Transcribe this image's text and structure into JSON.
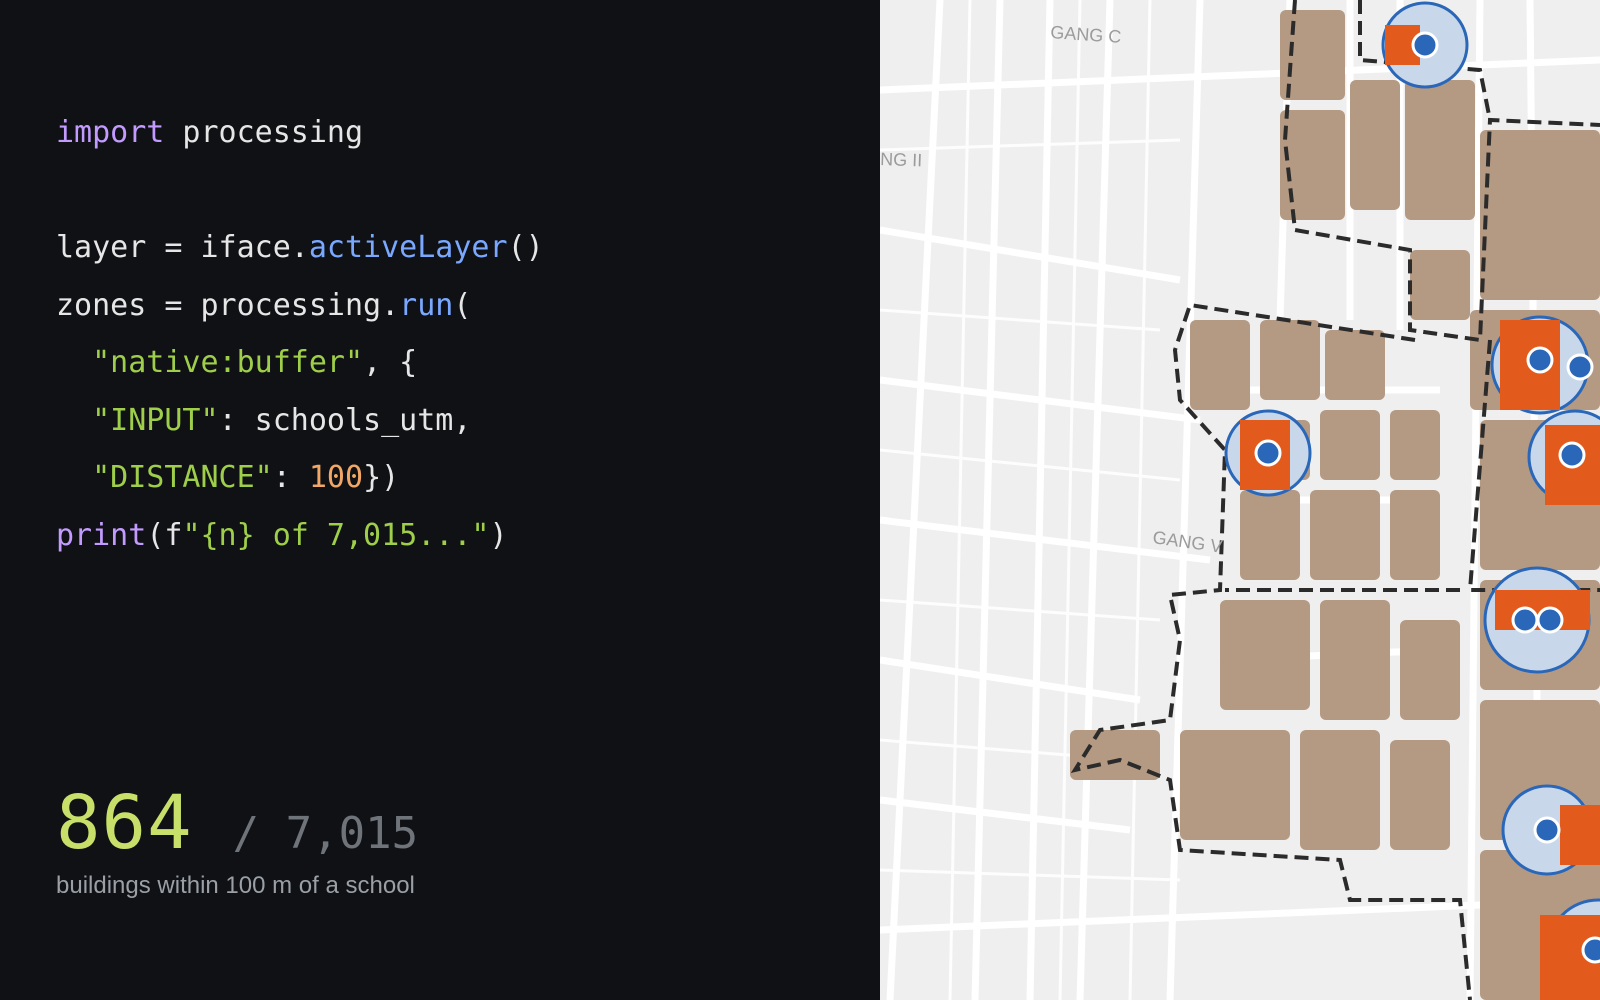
{
  "code_lines": [
    [
      {
        "t": "import",
        "c": "kw"
      },
      {
        "t": " processing",
        "c": ""
      }
    ],
    [],
    [
      {
        "t": "layer = iface.",
        "c": ""
      },
      {
        "t": "activeLayer",
        "c": "fn"
      },
      {
        "t": "()",
        "c": ""
      }
    ],
    [
      {
        "t": "zones = processing.",
        "c": ""
      },
      {
        "t": "run",
        "c": "fn"
      },
      {
        "t": "(",
        "c": ""
      }
    ],
    [
      {
        "t": "  ",
        "c": ""
      },
      {
        "t": "\"native:buffer\"",
        "c": "str"
      },
      {
        "t": ", {",
        "c": ""
      }
    ],
    [
      {
        "t": "  ",
        "c": ""
      },
      {
        "t": "\"INPUT\"",
        "c": "str"
      },
      {
        "t": ": schools_utm,",
        "c": ""
      }
    ],
    [
      {
        "t": "  ",
        "c": ""
      },
      {
        "t": "\"DISTANCE\"",
        "c": "str"
      },
      {
        "t": ": ",
        "c": ""
      },
      {
        "t": "100",
        "c": "num"
      },
      {
        "t": "})",
        "c": ""
      }
    ],
    [
      {
        "t": "print",
        "c": "kw"
      },
      {
        "t": "(f",
        "c": ""
      },
      {
        "t": "\"{n} of 7,015...\"",
        "c": "str"
      },
      {
        "t": ")",
        "c": ""
      }
    ]
  ],
  "stat": {
    "count": "864",
    "total": "/ 7,015",
    "caption": "buildings within 100 m of a school"
  },
  "map": {
    "street_labels": [
      "GANG C",
      "NG II",
      "GANG V"
    ]
  },
  "colors": {
    "highlight": "#c8e06a",
    "building": "#b59a83",
    "buffer_fill": "#c8d8ea",
    "buffer_stroke": "#2a67b8",
    "hit_building": "#e25a1c"
  }
}
